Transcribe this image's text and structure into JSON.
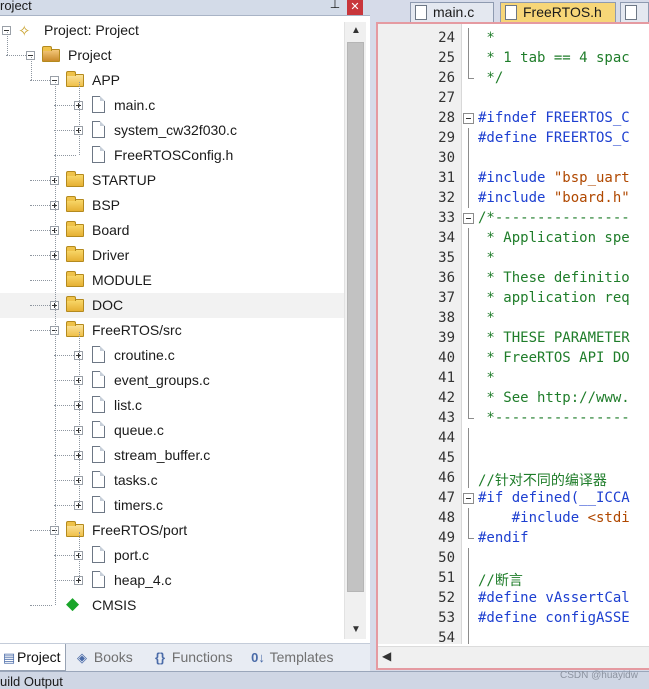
{
  "project_panel": {
    "title": "roject",
    "pin_glyph": "📌",
    "close_glyph": "✕",
    "tree": [
      {
        "label": "Project: Project",
        "icon": "target-icon",
        "depth": 0,
        "expander": "minus"
      },
      {
        "label": "Project",
        "icon": "project-folder-icon",
        "depth": 1,
        "expander": "minus"
      },
      {
        "label": "APP",
        "icon": "folder-open-icon",
        "depth": 2,
        "expander": "minus"
      },
      {
        "label": "main.c",
        "icon": "file-icon",
        "depth": 3,
        "expander": "plus"
      },
      {
        "label": "system_cw32f030.c",
        "icon": "file-icon",
        "depth": 3,
        "expander": "plus"
      },
      {
        "label": "FreeRTOSConfig.h",
        "icon": "file-icon",
        "depth": 3,
        "expander": "none"
      },
      {
        "label": "STARTUP",
        "icon": "folder-icon",
        "depth": 2,
        "expander": "plus"
      },
      {
        "label": "BSP",
        "icon": "folder-icon",
        "depth": 2,
        "expander": "plus"
      },
      {
        "label": "Board",
        "icon": "folder-icon",
        "depth": 2,
        "expander": "plus"
      },
      {
        "label": "Driver",
        "icon": "folder-icon",
        "depth": 2,
        "expander": "plus"
      },
      {
        "label": "MODULE",
        "icon": "folder-icon",
        "depth": 2,
        "expander": "none"
      },
      {
        "label": "DOC",
        "icon": "folder-icon",
        "depth": 2,
        "expander": "plus",
        "selected": true
      },
      {
        "label": "FreeRTOS/src",
        "icon": "folder-open-icon",
        "depth": 2,
        "expander": "minus"
      },
      {
        "label": "croutine.c",
        "icon": "file-icon",
        "depth": 3,
        "expander": "plus"
      },
      {
        "label": "event_groups.c",
        "icon": "file-icon",
        "depth": 3,
        "expander": "plus"
      },
      {
        "label": "list.c",
        "icon": "file-icon",
        "depth": 3,
        "expander": "plus"
      },
      {
        "label": "queue.c",
        "icon": "file-icon",
        "depth": 3,
        "expander": "plus"
      },
      {
        "label": "stream_buffer.c",
        "icon": "file-icon",
        "depth": 3,
        "expander": "plus"
      },
      {
        "label": "tasks.c",
        "icon": "file-icon",
        "depth": 3,
        "expander": "plus"
      },
      {
        "label": "timers.c",
        "icon": "file-icon",
        "depth": 3,
        "expander": "plus"
      },
      {
        "label": "FreeRTOS/port",
        "icon": "folder-open-icon",
        "depth": 2,
        "expander": "minus"
      },
      {
        "label": "port.c",
        "icon": "file-icon",
        "depth": 3,
        "expander": "plus"
      },
      {
        "label": "heap_4.c",
        "icon": "file-icon",
        "depth": 3,
        "expander": "plus"
      },
      {
        "label": "CMSIS",
        "icon": "cmsis-diamond-icon",
        "depth": 2,
        "expander": "none"
      }
    ],
    "bottom_tabs": [
      {
        "label": "Project",
        "icon": "project-tab-icon",
        "glyph": "▤",
        "active": true
      },
      {
        "label": "Books",
        "icon": "books-icon",
        "glyph": "◈",
        "active": false
      },
      {
        "label": "Functions",
        "icon": "functions-icon",
        "glyph": "{}",
        "active": false
      },
      {
        "label": "Templates",
        "icon": "templates-icon",
        "glyph": "0↓",
        "active": false
      }
    ]
  },
  "build_output": {
    "label": "uild Output"
  },
  "editor": {
    "tabs": [
      {
        "label": "main.c",
        "active": false
      },
      {
        "label": "FreeRTOS.h",
        "active": true
      },
      {
        "label": "",
        "active": false
      }
    ],
    "lines": [
      {
        "n": "24",
        "text": " *",
        "kind": "cm",
        "fold": "line"
      },
      {
        "n": "25",
        "text": " * 1 tab == 4 spac",
        "kind": "cm",
        "fold": "line"
      },
      {
        "n": "26",
        "text": " */",
        "kind": "cm",
        "fold": "end"
      },
      {
        "n": "27",
        "text": "",
        "kind": "",
        "fold": ""
      },
      {
        "n": "28",
        "text": "#ifndef FREERTOS_C",
        "kind": "pp",
        "fold": "box"
      },
      {
        "n": "29",
        "text": "#define FREERTOS_C",
        "kind": "pp",
        "fold": "line"
      },
      {
        "n": "30",
        "text": "",
        "kind": "",
        "fold": "line"
      },
      {
        "n": "31",
        "text": "#include \"bsp_uart",
        "kind": "inc",
        "fold": "line"
      },
      {
        "n": "32",
        "text": "#include \"board.h\"",
        "kind": "inc",
        "fold": "line"
      },
      {
        "n": "33",
        "text": "/*----------------",
        "kind": "cm",
        "fold": "box"
      },
      {
        "n": "34",
        "text": " * Application spe",
        "kind": "cm",
        "fold": "line"
      },
      {
        "n": "35",
        "text": " *",
        "kind": "cm",
        "fold": "line"
      },
      {
        "n": "36",
        "text": " * These definitio",
        "kind": "cm",
        "fold": "line"
      },
      {
        "n": "37",
        "text": " * application req",
        "kind": "cm",
        "fold": "line"
      },
      {
        "n": "38",
        "text": " *",
        "kind": "cm",
        "fold": "line"
      },
      {
        "n": "39",
        "text": " * THESE PARAMETER",
        "kind": "cm",
        "fold": "line"
      },
      {
        "n": "40",
        "text": " * FreeRTOS API DO",
        "kind": "cm",
        "fold": "line"
      },
      {
        "n": "41",
        "text": " *",
        "kind": "cm",
        "fold": "line"
      },
      {
        "n": "42",
        "text": " * See http://www.",
        "kind": "cm",
        "fold": "line"
      },
      {
        "n": "43",
        "text": " *----------------",
        "kind": "cm",
        "fold": "end"
      },
      {
        "n": "44",
        "text": "",
        "kind": "",
        "fold": "line"
      },
      {
        "n": "45",
        "text": "",
        "kind": "",
        "fold": "line"
      },
      {
        "n": "46",
        "text": "//针对不同的编译器",
        "kind": "cm",
        "fold": "line"
      },
      {
        "n": "47",
        "text": "#if defined(__ICCA",
        "kind": "pp",
        "fold": "box"
      },
      {
        "n": "48",
        "text": "    #include <stdi",
        "kind": "inc2",
        "fold": "line"
      },
      {
        "n": "49",
        "text": "#endif",
        "kind": "pp",
        "fold": "end"
      },
      {
        "n": "50",
        "text": "",
        "kind": "",
        "fold": "line"
      },
      {
        "n": "51",
        "text": "//断言",
        "kind": "cm",
        "fold": "line"
      },
      {
        "n": "52",
        "text": "#define vAssertCal",
        "kind": "pp",
        "fold": "line"
      },
      {
        "n": "53",
        "text": "#define configASSE",
        "kind": "pp",
        "fold": "line"
      },
      {
        "n": "54",
        "text": "",
        "kind": "",
        "fold": "line"
      }
    ]
  },
  "watermark": "CSDN @huayidw"
}
